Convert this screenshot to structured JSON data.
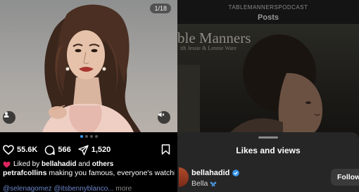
{
  "left_post": {
    "image_counter": "1/18",
    "likes": "55.6K",
    "comments": "566",
    "shares": "1,520",
    "liked_by": {
      "prefix": "Liked by",
      "user": "bellahadid",
      "suffix": "and",
      "others": "others"
    },
    "caption": {
      "username": "petrafcollins",
      "text": "making you famous, everyone's watching"
    },
    "tags": {
      "text": "@selenagomez @itsbennyblanco...",
      "more": "more"
    },
    "carousel": {
      "count": 4,
      "active_index": 0
    },
    "icons": {
      "like": "heart-icon",
      "comment": "comment-icon",
      "share": "share-icon",
      "save": "bookmark-icon",
      "tag": "person-tag-icon",
      "mute": "mute-icon"
    }
  },
  "right_panel": {
    "profile_handle": "TABLEMANNERSPODCAST",
    "section_title": "Posts",
    "video_overlay": {
      "title": "ble Manners",
      "subtitle": "ith Jessie & Lennie Ware"
    },
    "sheet": {
      "title": "Likes and views",
      "rows": [
        {
          "username": "bellahadid",
          "display_name": "Bella",
          "verified": true,
          "action": "Follow"
        }
      ]
    }
  },
  "colors": {
    "background": "#000000",
    "sheet": "#262626",
    "carousel_active": "#3897f0",
    "verified": "#3897f0",
    "tag_link": "#6b86c8"
  }
}
